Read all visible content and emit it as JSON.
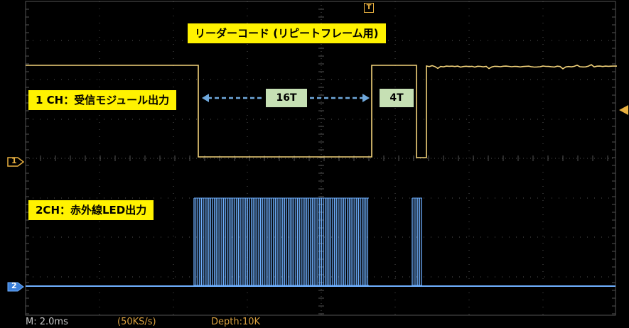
{
  "annotations": {
    "title": "リーダーコード (リピートフレーム用)",
    "ch1_label": "1 CH：受信モジュール出力",
    "ch2_label": "2CH：赤外線LED出力",
    "span_16t": "16T",
    "span_4t": "4T"
  },
  "markers": {
    "trigger": "T",
    "ch1": "1",
    "ch2": "2"
  },
  "status": {
    "timebase": "M: 2.0ms",
    "sample_rate": "(50KS/s)",
    "depth": "Depth:10K"
  },
  "colors": {
    "ch1_trace": "#f2d27a",
    "ch2_trace": "#6fb0ff",
    "grid": "#555555",
    "label_bg": "#fff200",
    "tag_bg": "#c6e0b4",
    "arrow": "#6fa8dc",
    "marker_amber": "#e8b040"
  }
}
